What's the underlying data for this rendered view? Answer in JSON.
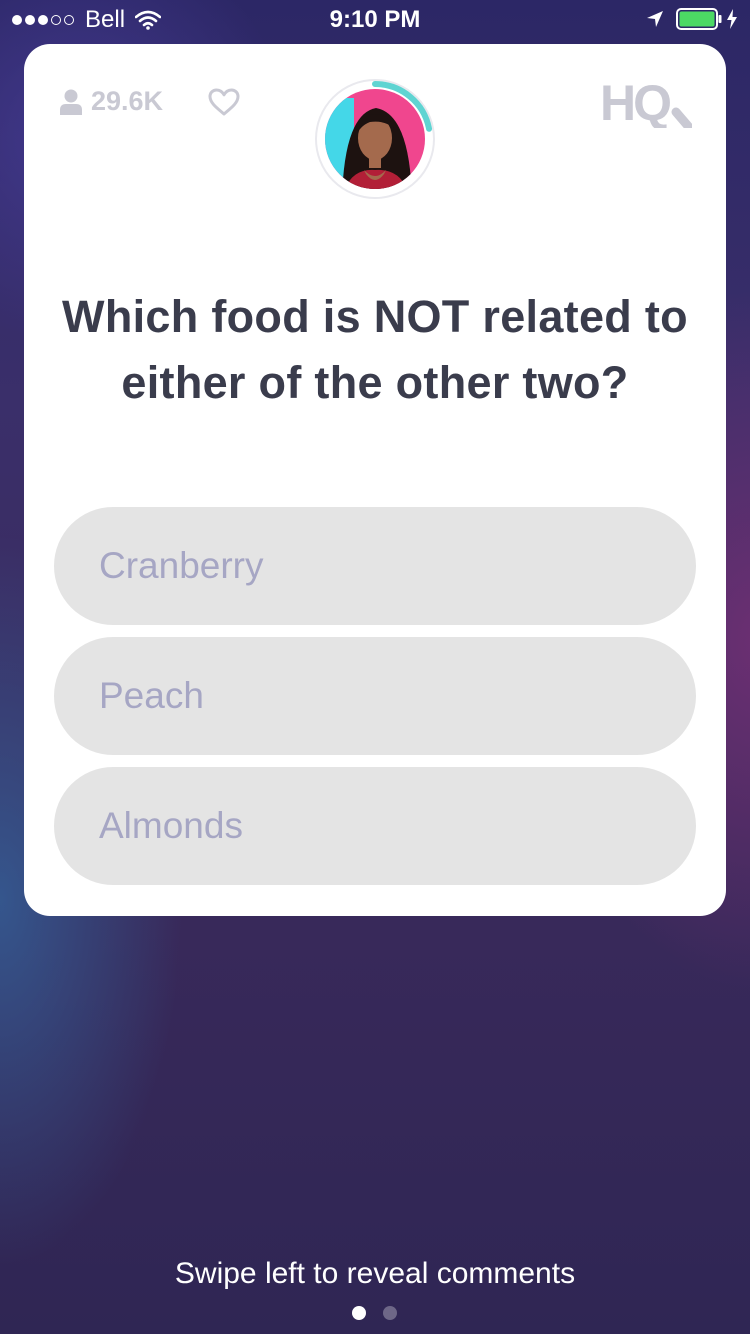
{
  "status_bar": {
    "carrier": "Bell",
    "time": "9:10 PM",
    "signal_filled": 3,
    "signal_total": 5,
    "battery_level": 1.0,
    "battery_color": "#4cd964"
  },
  "card": {
    "viewer_count": "29.6K",
    "logo": "HQ",
    "question": "Which food is NOT related to either of the other two?",
    "timer_progress": 0.22,
    "timer_color": "#5fd4d2",
    "answers": [
      {
        "label": "Cranberry"
      },
      {
        "label": "Peach"
      },
      {
        "label": "Almonds"
      }
    ]
  },
  "footer": {
    "hint": "Swipe left to reveal comments",
    "page_count": 2,
    "active_page": 1
  },
  "colors": {
    "question_text": "#3a3c4c",
    "answer_text": "#a6a6c4",
    "answer_background": "#e4e4e4",
    "header_icons": "#c9c9d3"
  },
  "icons": {
    "viewers": "person-icon",
    "like": "heart-icon",
    "wifi": "wifi-icon",
    "location": "location-arrow-icon",
    "battery": "battery-icon",
    "charging": "bolt-icon"
  }
}
